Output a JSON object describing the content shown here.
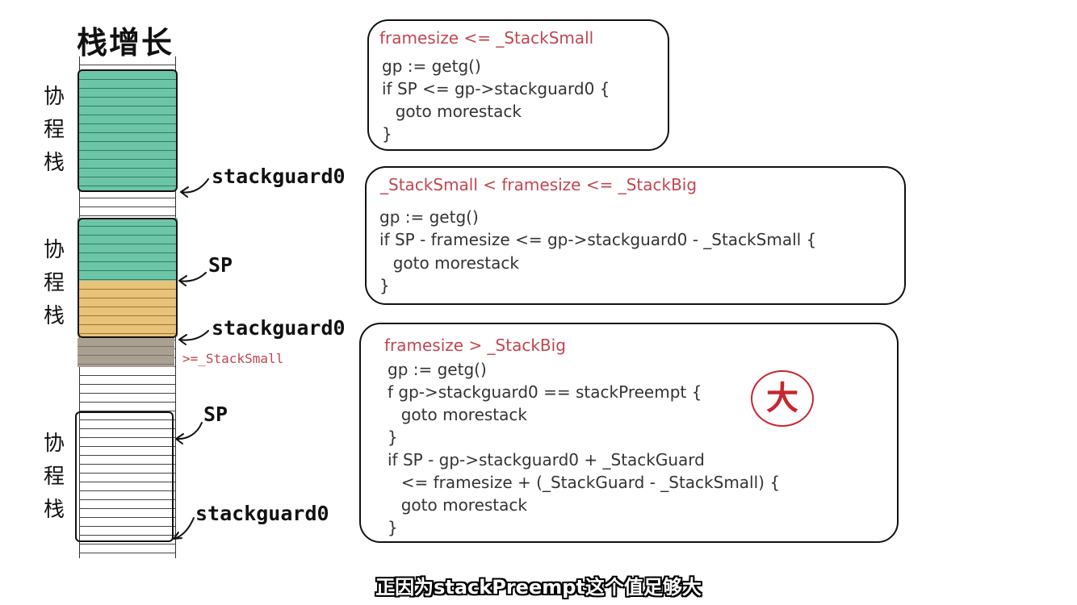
{
  "title": "栈增长",
  "coroutine_label": "协程栈",
  "stack_labels": {
    "stackguard0": "stackguard0",
    "sp": "SP",
    "stack_small_note": ">=_StackSmall"
  },
  "colors": {
    "green": "#6cc5a6",
    "orange": "#e9c27a",
    "gray": "#aaa092",
    "red": "#c0464f",
    "stamp": "#c7262e"
  },
  "code_boxes": [
    {
      "header": "framesize <= _StackSmall",
      "lines": [
        "gp := getg()",
        "if SP <= gp->stackguard0 {",
        "  goto morestack",
        "}"
      ]
    },
    {
      "header": "_StackSmall < framesize <= _StackBig",
      "lines": [
        "gp := getg()",
        "if SP - framesize <= gp->stackguard0 - _StackSmall {",
        "  goto morestack",
        "}"
      ]
    },
    {
      "header": "framesize > _StackBig",
      "lines": [
        "gp := getg()",
        "f gp->stackguard0 == stackPreempt {",
        "  goto morestack",
        "}",
        "if SP - gp->stackguard0 + _StackGuard",
        "  <= framesize + (_StackGuard - _StackSmall) {",
        "  goto morestack",
        "}"
      ]
    }
  ],
  "stamp": "大",
  "subtitle": "正因为stackPreempt这个值足够大"
}
